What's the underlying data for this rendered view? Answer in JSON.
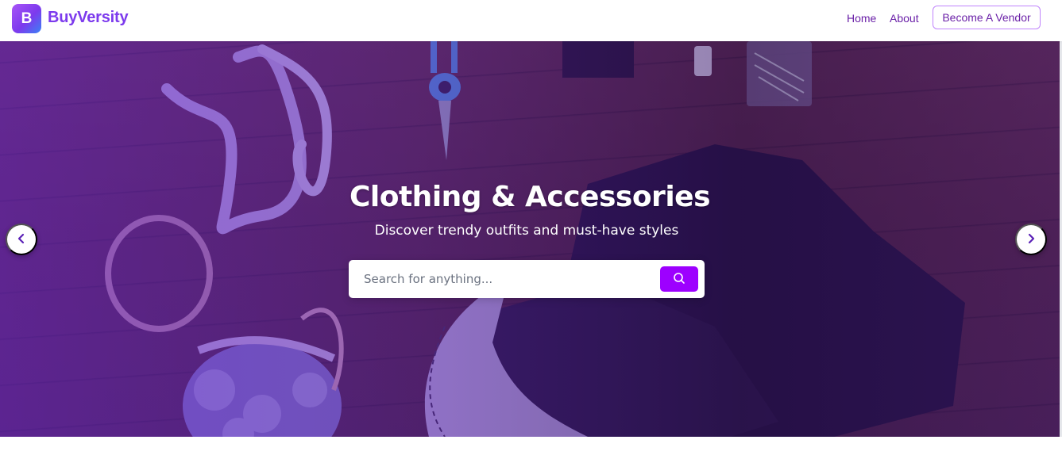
{
  "header": {
    "logo_letter": "B",
    "brand_name": "BuyVersity",
    "nav": {
      "home": "Home",
      "about": "About",
      "become_vendor": "Become A Vendor"
    }
  },
  "hero": {
    "title": "Clothing & Accessories",
    "subtitle": "Discover trendy outfits and must-have styles",
    "search": {
      "placeholder": "Search for anything...",
      "value": "",
      "button_icon": "search-icon"
    },
    "prev_icon": "chevron-left-icon",
    "next_icon": "chevron-right-icon"
  },
  "colors": {
    "brand": "#7c3aed",
    "accent": "#9d00ff",
    "nav_text": "#6b21a8",
    "overlay": "#6d28d9"
  }
}
